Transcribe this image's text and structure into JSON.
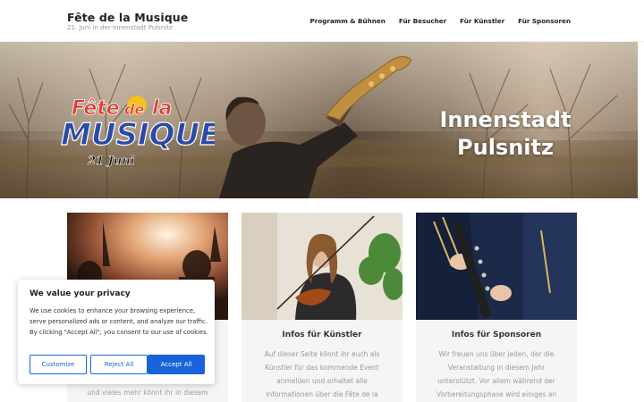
{
  "site": {
    "title": "Fête de la Musique",
    "tagline": "21. Juni in der Innenstadt Pulsnitz"
  },
  "nav": {
    "items": [
      "Programm & Bühnen",
      "Für Besucher",
      "Für Künstler",
      "Für Sponsoren"
    ]
  },
  "hero": {
    "heading_line1": "Innenstadt",
    "heading_line2": "Pulsnitz",
    "logo": {
      "line1": "Fête de la",
      "line2": "MUSIQUE",
      "line3": "21 Juni"
    }
  },
  "cards": [
    {
      "title": "",
      "text": "und vieles mehr könnt ihr in diesem"
    },
    {
      "title": "Infos für Künstler",
      "text": "Auf dieser Seite könnt ihr euch als Künstler für das kommende Event anmelden und erhaltet alle Informationen über die Fête de la"
    },
    {
      "title": "Infos für Sponsoren",
      "text": "Wir freuen uns über jeden, der die Veranstaltung in diesem Jahr unterstützt. Vor allem während der Vorbereitungsphase wird einiges an"
    }
  ],
  "cookie": {
    "title": "We value your privacy",
    "text": "We use cookies to enhance your browsing experience, serve personalized ads or content, and analyze our traffic. By clicking \"Accept All\", you consent to our use of cookies.",
    "customize_label": "Customize",
    "reject_label": "Reject All",
    "accept_label": "Accept All"
  },
  "colors": {
    "accent": "#1863dc",
    "card_bg": "#f5f5f5"
  }
}
